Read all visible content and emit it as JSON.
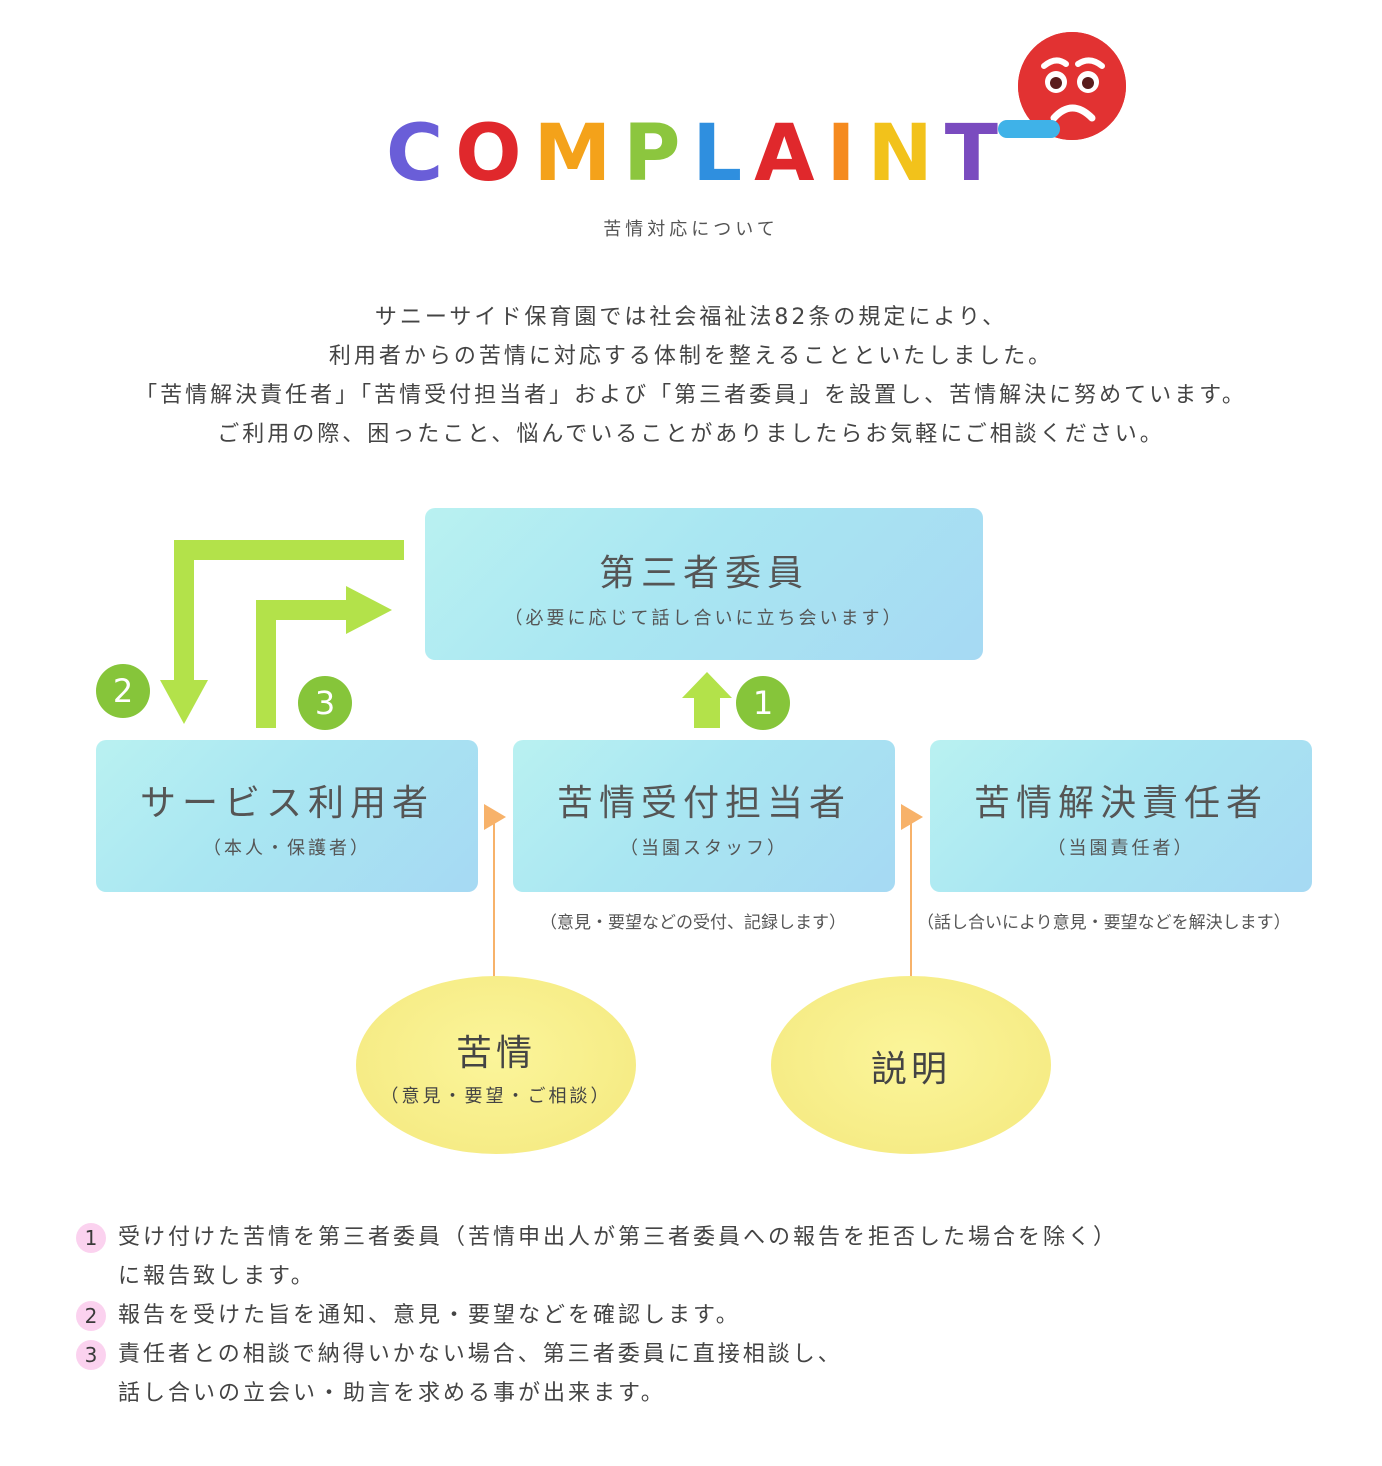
{
  "header": {
    "logo_letters": [
      {
        "char": "C",
        "color": "#6a5ed8"
      },
      {
        "char": "O",
        "color": "#e0282c"
      },
      {
        "char": "M",
        "color": "#f4a21a"
      },
      {
        "char": "P",
        "color": "#8cc63e"
      },
      {
        "char": "L",
        "color": "#2f8fdf"
      },
      {
        "char": "A",
        "color": "#e0282c"
      },
      {
        "char": "I",
        "color": "#f58a1f"
      },
      {
        "char": "N",
        "color": "#f2c21b"
      },
      {
        "char": "T",
        "color": "#7a4bbf"
      }
    ],
    "subtitle": "苦情対応について",
    "face_icon": "sad-face-icon",
    "face_color": "#e23232"
  },
  "intro": {
    "lines": [
      "サニーサイド保育園では社会福祉法82条の規定により、",
      "利用者からの苦情に対応する体制を整えることといたしました。",
      "「苦情解決責任者」「苦情受付担当者」および「第三者委員」を設置し、苦情解決に努めています。",
      "ご利用の際、困ったこと、悩んでいることがありましたらお気軽にご相談ください。"
    ]
  },
  "diagram": {
    "third_party": {
      "title": "第三者委員",
      "sub": "（必要に応じて話し合いに立ち会います）"
    },
    "user": {
      "title": "サービス利用者",
      "sub": "（本人・保護者）"
    },
    "reception": {
      "title": "苦情受付担当者",
      "sub": "（当園スタッフ）",
      "note": "（意見・要望などの受付、記録します）"
    },
    "resolver": {
      "title": "苦情解決責任者",
      "sub": "（当園責任者）",
      "note": "（話し合いにより意見・要望などを解決します）"
    },
    "complaint": {
      "title": "苦情",
      "sub": "（意見・要望・ご相談）"
    },
    "explanation": {
      "title": "説明"
    },
    "badges": [
      "1",
      "2",
      "3"
    ],
    "colors": {
      "arrow_green": "#b3e24a",
      "badge_green": "#86c53a",
      "connector_orange": "#f7b26a",
      "box_blue": "#a9e6f2",
      "ellipse_yellow": "#f6ec86"
    }
  },
  "notes": {
    "items": [
      {
        "num": "1",
        "line1": "受け付けた苦情を第三者委員（苦情申出人が第三者委員への報告を拒否した場合を除く）",
        "line2": "に報告致します。"
      },
      {
        "num": "2",
        "line1": "報告を受けた旨を通知、意見・要望などを確認します。",
        "line2": ""
      },
      {
        "num": "3",
        "line1": "責任者との相談で納得いかない場合、第三者委員に直接相談し、",
        "line2": "話し合いの立会い・助言を求める事が出来ます。"
      }
    ]
  }
}
